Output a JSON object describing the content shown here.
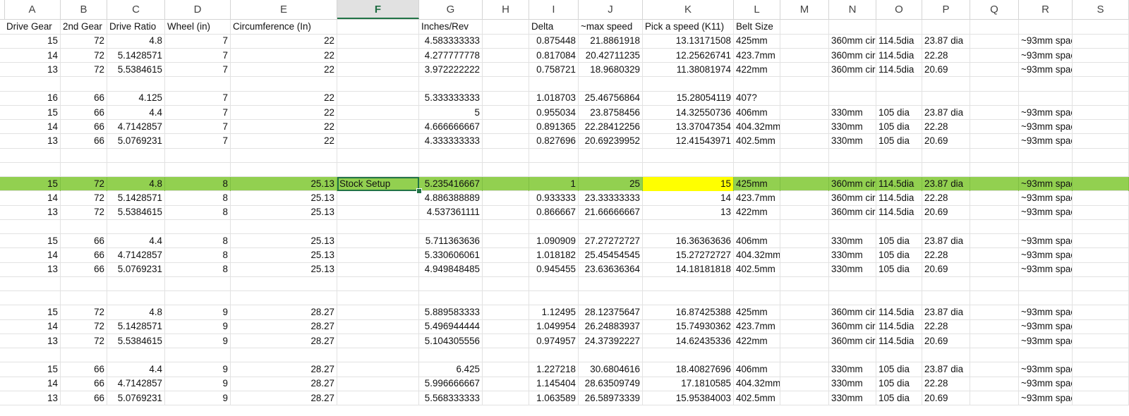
{
  "columns": [
    "A",
    "B",
    "C",
    "D",
    "E",
    "F",
    "G",
    "H",
    "I",
    "J",
    "K",
    "L",
    "M",
    "N",
    "O",
    "P",
    "Q",
    "R",
    "S"
  ],
  "selected_column": "F",
  "rows": [
    {
      "cells": {
        "A": "Drive Gear",
        "B": "2nd Gear",
        "C": "Drive Ratio",
        "D": "Wheel (in)",
        "E": "Circumference  (In)",
        "G": "Inches/Rev",
        "I": "Delta",
        "J": "~max speed",
        "K": "Pick a speed (K11)",
        "L": "Belt Size"
      },
      "header": true
    },
    {
      "cells": {
        "A": "15",
        "B": "72",
        "C": "4.8",
        "D": "7",
        "E": "22",
        "G": "4.583333333",
        "I": "0.875448",
        "J": "21.8861918",
        "K": "13.13171508",
        "L": "425mm",
        "N": "360mm cir",
        "O": "114.5dia",
        "P": "23.87 dia",
        "R": "~93mm spacing"
      }
    },
    {
      "cells": {
        "A": "14",
        "B": "72",
        "C": "5.1428571",
        "D": "7",
        "E": "22",
        "G": "4.277777778",
        "I": "0.817084",
        "J": "20.42711235",
        "K": "12.25626741",
        "L": "423.7mm",
        "N": "360mm cir",
        "O": "114.5dia",
        "P": "22.28",
        "R": "~93mm spacing"
      }
    },
    {
      "cells": {
        "A": "13",
        "B": "72",
        "C": "5.5384615",
        "D": "7",
        "E": "22",
        "G": "3.972222222",
        "I": "0.758721",
        "J": "18.9680329",
        "K": "11.38081974",
        "L": "422mm",
        "N": "360mm cir",
        "O": "114.5dia",
        "P": "20.69",
        "R": "~93mm spacing"
      }
    },
    {
      "cells": {}
    },
    {
      "cells": {
        "A": "16",
        "B": "66",
        "C": "4.125",
        "D": "7",
        "E": "22",
        "G": "5.333333333",
        "I": "1.018703",
        "J": "25.46756864",
        "K": "15.28054119",
        "L": "407?"
      }
    },
    {
      "cells": {
        "A": "15",
        "B": "66",
        "C": "4.4",
        "D": "7",
        "E": "22",
        "G": "5",
        "I": "0.955034",
        "J": "23.8758456",
        "K": "14.32550736",
        "L": "406mm",
        "N": "330mm",
        "O": "105 dia",
        "P": "23.87 dia",
        "R": "~93mm spacing"
      }
    },
    {
      "cells": {
        "A": "14",
        "B": "66",
        "C": "4.7142857",
        "D": "7",
        "E": "22",
        "G": "4.666666667",
        "I": "0.891365",
        "J": "22.28412256",
        "K": "13.37047354",
        "L": "404.32mm",
        "N": "330mm",
        "O": "105 dia",
        "P": "22.28",
        "R": "~93mm spacing"
      }
    },
    {
      "cells": {
        "A": "13",
        "B": "66",
        "C": "5.0769231",
        "D": "7",
        "E": "22",
        "G": "4.333333333",
        "I": "0.827696",
        "J": "20.69239952",
        "K": "12.41543971",
        "L": "402.5mm",
        "N": "330mm",
        "O": "105 dia",
        "P": "20.69",
        "R": "~93mm spacing"
      }
    },
    {
      "cells": {}
    },
    {
      "cells": {}
    },
    {
      "cells": {
        "A": "15",
        "B": "72",
        "C": "4.8",
        "D": "8",
        "E": "25.13",
        "F": "Stock Setup",
        "G": "5.235416667",
        "I": "1",
        "J": "25",
        "K": "15",
        "L": "425mm",
        "N": "360mm cir",
        "O": "114.5dia",
        "P": "23.87 dia",
        "R": "~93mm spacing"
      },
      "highlight": true
    },
    {
      "cells": {
        "A": "14",
        "B": "72",
        "C": "5.1428571",
        "D": "8",
        "E": "25.13",
        "G": "4.886388889",
        "I": "0.933333",
        "J": "23.33333333",
        "K": "14",
        "L": "423.7mm",
        "N": "360mm cir",
        "O": "114.5dia",
        "P": "22.28",
        "R": "~93mm spacing"
      }
    },
    {
      "cells": {
        "A": "13",
        "B": "72",
        "C": "5.5384615",
        "D": "8",
        "E": "25.13",
        "G": "4.537361111",
        "I": "0.866667",
        "J": "21.66666667",
        "K": "13",
        "L": "422mm",
        "N": "360mm cir",
        "O": "114.5dia",
        "P": "20.69",
        "R": "~93mm spacing"
      }
    },
    {
      "cells": {}
    },
    {
      "cells": {
        "A": "15",
        "B": "66",
        "C": "4.4",
        "D": "8",
        "E": "25.13",
        "G": "5.711363636",
        "I": "1.090909",
        "J": "27.27272727",
        "K": "16.36363636",
        "L": "406mm",
        "N": "330mm",
        "O": "105 dia",
        "P": "23.87 dia",
        "R": "~93mm spacing"
      }
    },
    {
      "cells": {
        "A": "14",
        "B": "66",
        "C": "4.7142857",
        "D": "8",
        "E": "25.13",
        "G": "5.330606061",
        "I": "1.018182",
        "J": "25.45454545",
        "K": "15.27272727",
        "L": "404.32mm",
        "N": "330mm",
        "O": "105 dia",
        "P": "22.28",
        "R": "~93mm spacing"
      }
    },
    {
      "cells": {
        "A": "13",
        "B": "66",
        "C": "5.0769231",
        "D": "8",
        "E": "25.13",
        "G": "4.949848485",
        "I": "0.945455",
        "J": "23.63636364",
        "K": "14.18181818",
        "L": "402.5mm",
        "N": "330mm",
        "O": "105 dia",
        "P": "20.69",
        "R": "~93mm spacing"
      }
    },
    {
      "cells": {}
    },
    {
      "cells": {}
    },
    {
      "cells": {
        "A": "15",
        "B": "72",
        "C": "4.8",
        "D": "9",
        "E": "28.27",
        "G": "5.889583333",
        "I": "1.12495",
        "J": "28.12375647",
        "K": "16.87425388",
        "L": "425mm",
        "N": "360mm cir",
        "O": "114.5dia",
        "P": "23.87 dia",
        "R": "~93mm spacing"
      }
    },
    {
      "cells": {
        "A": "14",
        "B": "72",
        "C": "5.1428571",
        "D": "9",
        "E": "28.27",
        "G": "5.496944444",
        "I": "1.049954",
        "J": "26.24883937",
        "K": "15.74930362",
        "L": "423.7mm",
        "N": "360mm cir",
        "O": "114.5dia",
        "P": "22.28",
        "R": "~93mm spacing"
      }
    },
    {
      "cells": {
        "A": "13",
        "B": "72",
        "C": "5.5384615",
        "D": "9",
        "E": "28.27",
        "G": "5.104305556",
        "I": "0.974957",
        "J": "24.37392227",
        "K": "14.62435336",
        "L": "422mm",
        "N": "360mm cir",
        "O": "114.5dia",
        "P": "20.69",
        "R": "~93mm spacing"
      }
    },
    {
      "cells": {}
    },
    {
      "cells": {
        "A": "15",
        "B": "66",
        "C": "4.4",
        "D": "9",
        "E": "28.27",
        "G": "6.425",
        "I": "1.227218",
        "J": "30.6804616",
        "K": "18.40827696",
        "L": "406mm",
        "N": "330mm",
        "O": "105 dia",
        "P": "23.87 dia",
        "R": "~93mm spacing"
      }
    },
    {
      "cells": {
        "A": "14",
        "B": "66",
        "C": "4.7142857",
        "D": "9",
        "E": "28.27",
        "G": "5.996666667",
        "I": "1.145404",
        "J": "28.63509749",
        "K": "17.1810585",
        "L": "404.32mm",
        "N": "330mm",
        "O": "105 dia",
        "P": "22.28",
        "R": "~93mm spacing"
      }
    },
    {
      "cells": {
        "A": "13",
        "B": "66",
        "C": "5.0769231",
        "D": "9",
        "E": "28.27",
        "G": "5.568333333",
        "I": "1.063589",
        "J": "26.58973339",
        "K": "15.95384003",
        "L": "402.5mm",
        "N": "330mm",
        "O": "105 dia",
        "P": "20.69",
        "R": "~93mm spacing"
      }
    }
  ],
  "colors": {
    "highlight_row": "#92d050",
    "yellow_cell": "#ffff00",
    "selection": "#217346"
  }
}
